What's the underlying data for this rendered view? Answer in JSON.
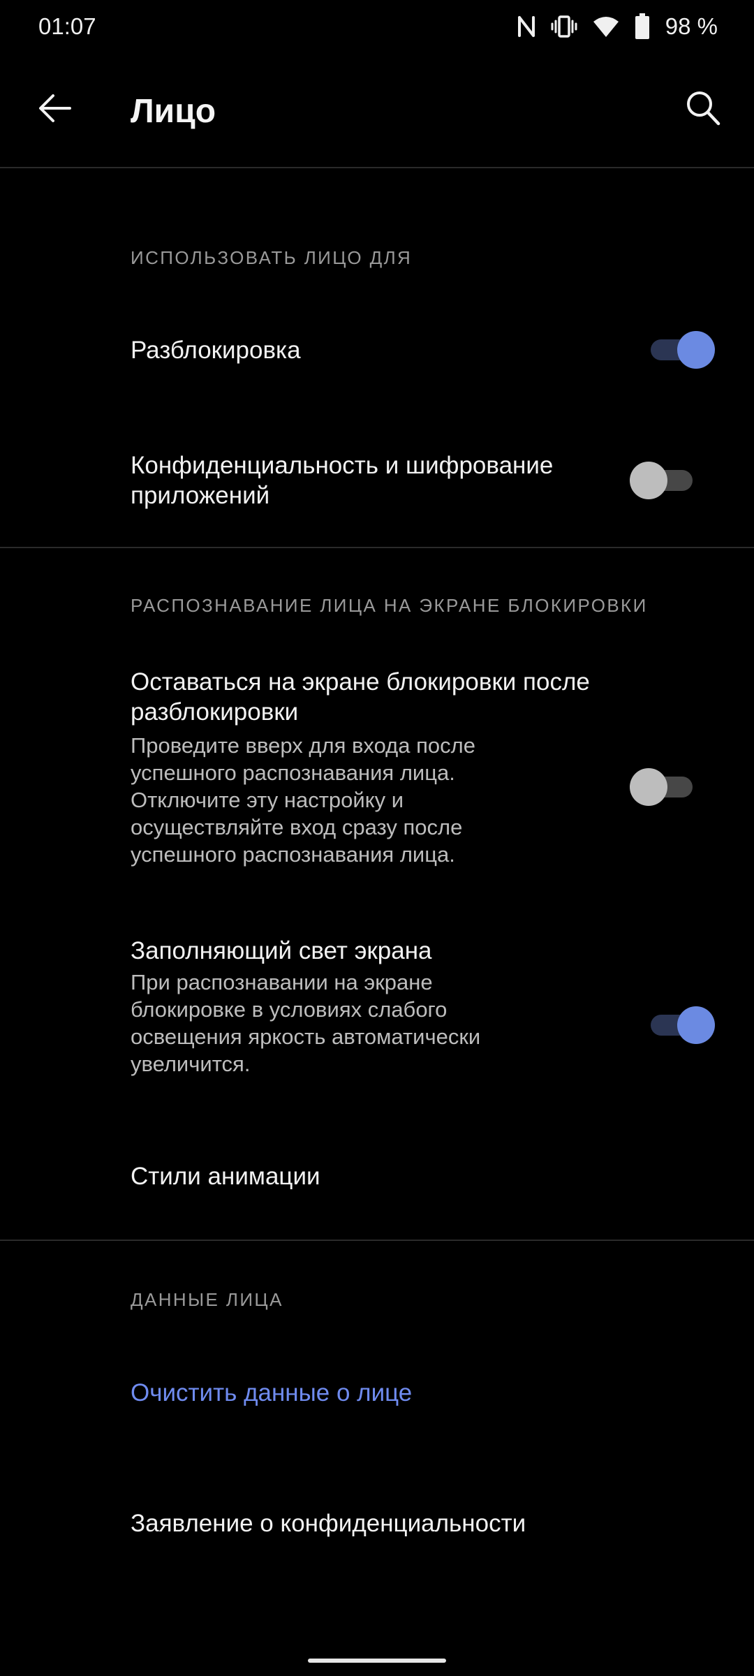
{
  "status_bar": {
    "time": "01:07",
    "battery_text": "98 %",
    "icons": [
      "nfc-icon",
      "vibrate-icon",
      "wifi-icon",
      "battery-icon"
    ]
  },
  "app_bar": {
    "title": "Лицо",
    "back_icon": "arrow-left-icon",
    "search_icon": "search-icon"
  },
  "sections": {
    "use_face": {
      "header": "ИСПОЛЬЗОВАТЬ ЛИЦО ДЛЯ",
      "unlock": {
        "title": "Разблокировка",
        "enabled": true
      },
      "app_privacy": {
        "title": "Конфиденциальность и шифрование приложений",
        "enabled": false
      }
    },
    "lock_screen": {
      "header": "РАСПОЗНАВАНИЕ ЛИЦА НА ЭКРАНЕ БЛОКИРОВКИ",
      "stay_on_lock": {
        "title": "Оставаться на экране блокировки после разблокировки",
        "summary": "Проведите вверх для входа после успешного распознавания лица. Отключите эту настройку и осуществляйте вход сразу после успешного распознавания лица.",
        "enabled": false
      },
      "fill_light": {
        "title": "Заполняющий свет экрана",
        "summary": "При распознавании на экране блокировке в условиях слабого освещения яркость автоматически увеличится.",
        "enabled": true
      },
      "animation_styles": {
        "title": "Стили анимации"
      }
    },
    "face_data": {
      "header": "ДАННЫЕ ЛИЦА",
      "clear": {
        "title": "Очистить данные о лице"
      },
      "privacy_statement": {
        "title": "Заявление о конфиденциальности"
      }
    }
  },
  "colors": {
    "background": "#000000",
    "accent": "#6b8ae2",
    "link": "#6f8bef",
    "section_header": "#9a9a9a",
    "summary_text": "#bdbdbd"
  }
}
